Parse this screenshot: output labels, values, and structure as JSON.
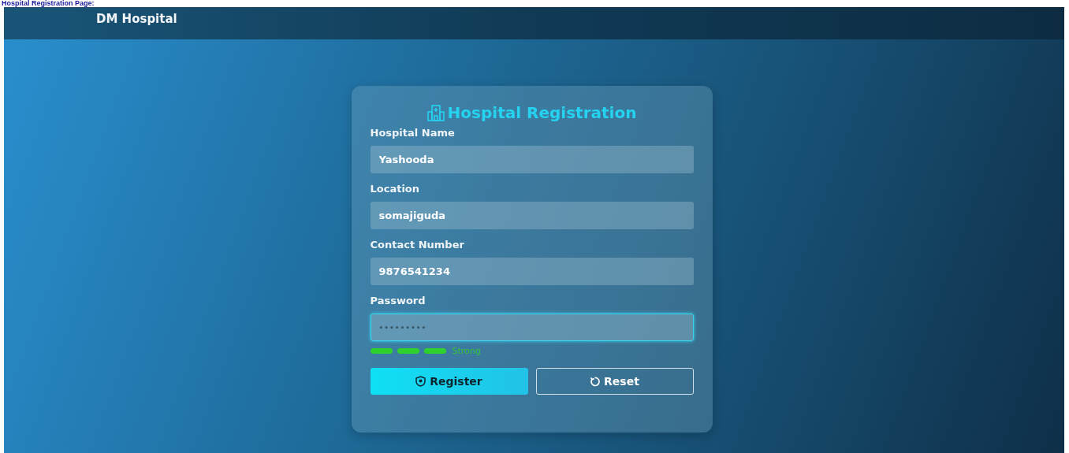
{
  "caption": "Hospital Registration Page:",
  "header": {
    "brand": "DM Hospital"
  },
  "form": {
    "title": "Hospital Registration",
    "fields": [
      {
        "label": "Hospital Name",
        "value": "Yashooda",
        "kind": "text",
        "focused": false
      },
      {
        "label": "Location",
        "value": "somajiguda",
        "kind": "text",
        "focused": false
      },
      {
        "label": "Contact Number",
        "value": "9876541234",
        "kind": "text",
        "focused": false
      },
      {
        "label": "Password",
        "value": "•••••••••",
        "kind": "password",
        "focused": true
      }
    ],
    "strength": {
      "segments": [
        {
          "filled": true
        },
        {
          "filled": true
        },
        {
          "filled": true
        }
      ],
      "label": "Strong"
    },
    "buttons": [
      {
        "label": "Register",
        "kind": "primary"
      },
      {
        "label": "Reset",
        "kind": "outline"
      }
    ]
  }
}
